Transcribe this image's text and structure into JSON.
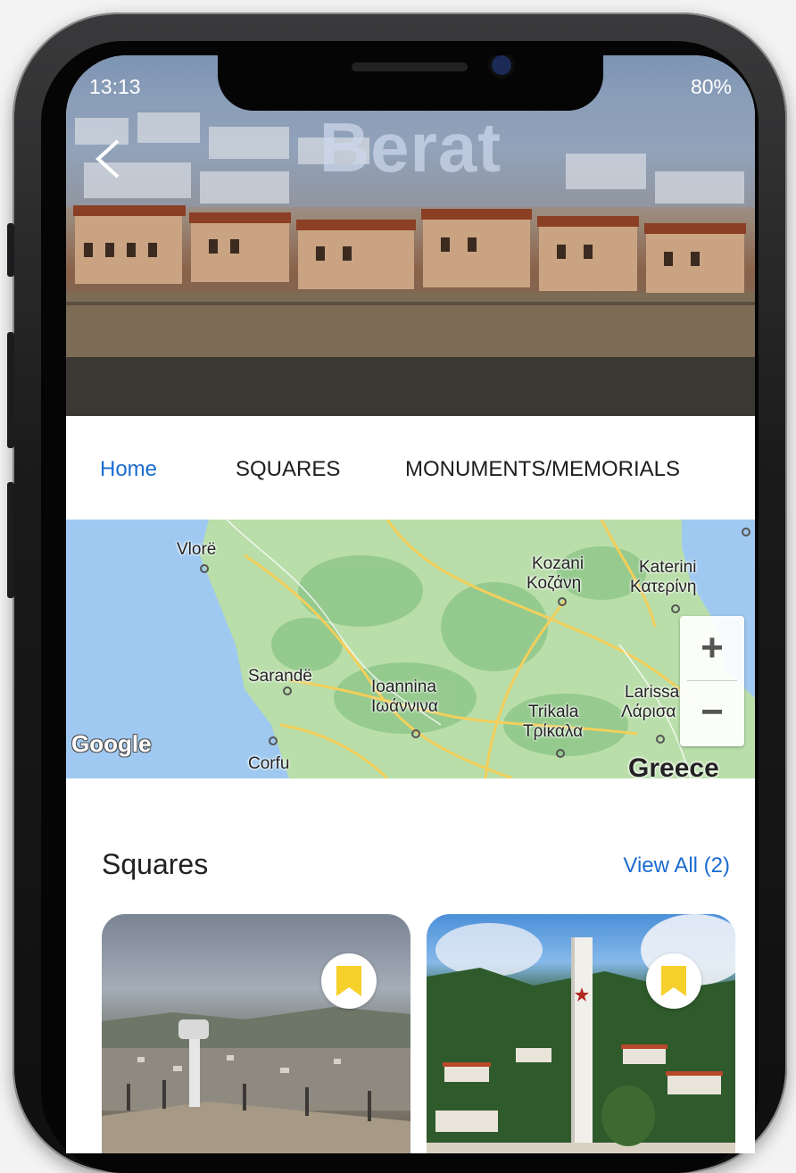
{
  "status_bar": {
    "time": "13:13",
    "battery": "80%"
  },
  "header": {
    "title": "Berat"
  },
  "tabs": [
    {
      "label": "Home",
      "active": true
    },
    {
      "label": "SQUARES",
      "active": false
    },
    {
      "label": "MONUMENTS/MEMORIALS",
      "active": false
    }
  ],
  "map": {
    "labels": {
      "vlore": "Vlorë",
      "kozani": "Kozani",
      "kozani_gr": "Κοζάνη",
      "katerini": "Katerini",
      "katerini_gr": "Κατερίνη",
      "sarande": "Sarandë",
      "ioannina": "Ioannina",
      "ioannina_gr": "Ιωάννινα",
      "trikala": "Trikala",
      "trikala_gr": "Τρίκαλα",
      "larissa": "Larissa",
      "larissa_gr": "Λάρισα",
      "corfu": "Corfu",
      "greece": "Greece"
    },
    "logo": "Google",
    "zoom_in": "+",
    "zoom_out": "−"
  },
  "squares": {
    "title": "Squares",
    "view_all": "View All (2)"
  },
  "colors": {
    "accent": "#1a6bd0",
    "bookmark": "#f6d02b"
  }
}
